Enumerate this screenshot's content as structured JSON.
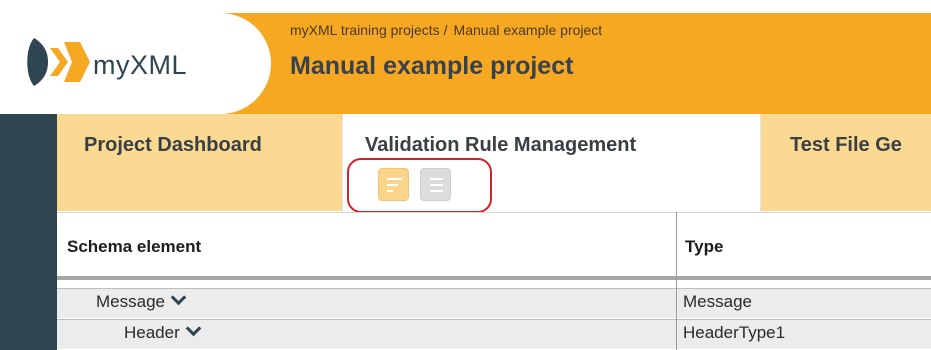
{
  "header": {
    "logo_text": "myXML",
    "breadcrumb": {
      "parent": "myXML training projects",
      "separator": "/",
      "current": "Manual example project"
    },
    "page_title": "Manual example project"
  },
  "tabs": [
    {
      "label": "Project Dashboard",
      "active": false
    },
    {
      "label": "Validation Rule Management",
      "active": true
    },
    {
      "label": "Test File Ge",
      "active": false
    }
  ],
  "toolbar": {
    "buttons": [
      "sort-icon",
      "list-icon"
    ]
  },
  "grid": {
    "columns": [
      "Schema element",
      "Type"
    ],
    "rows": [
      {
        "element": "Message",
        "type": "Message",
        "expanded": true,
        "indent": 0
      },
      {
        "element": "Header",
        "type": "HeaderType1",
        "expanded": true,
        "indent": 1
      }
    ]
  },
  "colors": {
    "accent": "#f7a823",
    "tab_bg": "#fad993",
    "rail": "#2f4552",
    "highlight": "#d4202a"
  }
}
